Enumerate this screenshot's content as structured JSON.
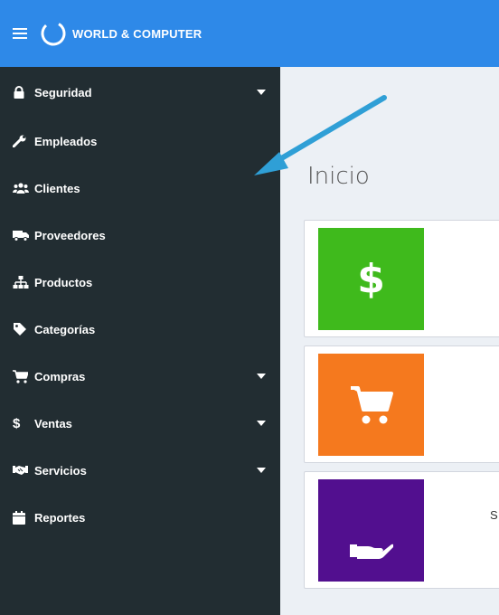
{
  "header": {
    "brand_name": "WORLD & COMPUTER",
    "color": "#2e89e8"
  },
  "sidebar": {
    "background": "#222d32",
    "items": [
      {
        "label": "Seguridad",
        "icon": "lock-icon",
        "has_submenu": true
      },
      {
        "label": "Empleados",
        "icon": "wrench-icon",
        "has_submenu": false
      },
      {
        "label": "Clientes",
        "icon": "users-icon",
        "has_submenu": false
      },
      {
        "label": "Proveedores",
        "icon": "truck-icon",
        "has_submenu": false
      },
      {
        "label": "Productos",
        "icon": "sitemap-icon",
        "has_submenu": false
      },
      {
        "label": "Categorías",
        "icon": "tag-icon",
        "has_submenu": false
      },
      {
        "label": "Compras",
        "icon": "cart-icon",
        "has_submenu": true
      },
      {
        "label": "Ventas",
        "icon": "dollar-icon",
        "has_submenu": true
      },
      {
        "label": "Servicios",
        "icon": "handshake-icon",
        "has_submenu": true
      },
      {
        "label": "Reportes",
        "icon": "calendar-icon",
        "has_submenu": false
      }
    ]
  },
  "main": {
    "title": "Inicio",
    "cards": [
      {
        "icon": "dollar-icon",
        "color": "#3fba1c",
        "text": ""
      },
      {
        "icon": "cart-icon",
        "color": "#f5791e",
        "text": ""
      },
      {
        "icon": "hand-icon",
        "color": "#520f8f",
        "text": "S"
      }
    ]
  }
}
